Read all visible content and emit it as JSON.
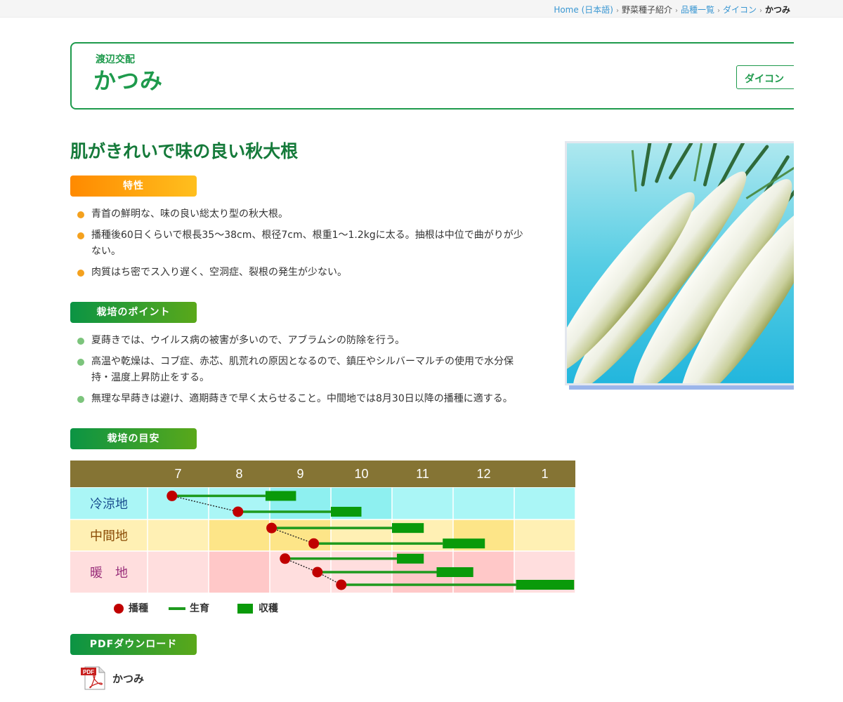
{
  "breadcrumb": {
    "home": "Home (日本語)",
    "items": [
      "野菜種子紹介",
      "品種一覧",
      "ダイコン"
    ],
    "current": "かつみ",
    "separator": "›"
  },
  "header": {
    "subtitle": "渡辺交配",
    "title": "かつみ",
    "category_button": "ダイコン"
  },
  "headline": "肌がきれいで味の良い秋大根",
  "features": {
    "label": "特性",
    "items": [
      "青首の鮮明な、味の良い総太り型の秋大根。",
      "播種後60日くらいで根長35〜38cm、根径7cm、根重1〜1.2kgに太る。抽根は中位で曲がりが少",
      "ない。",
      "肉質はち密でス入り遅く、空洞症、裂根の発生が少ない。"
    ]
  },
  "points": {
    "label": "栽培のポイント",
    "items": [
      "夏蒔きでは、ウイルス病の被害が多いので、アブラムシの防除を行う。",
      "高温や乾燥は、コブ症、赤芯、肌荒れの原因となるので、鎮圧やシルバーマルチの使用で水分保",
      "持・温度上昇防止をする。",
      "無理な早蒔きは避け、適期蒔きで早く太らせること。中間地では8月30日以降の播種に適する。"
    ]
  },
  "schedule": {
    "label": "栽培の目安",
    "months": [
      "7",
      "8",
      "9",
      "10",
      "11",
      "12",
      "1"
    ],
    "regions": [
      {
        "name": "冷涼地",
        "band_color": "#aaf6f6",
        "shade_color": "#8ef0f0",
        "shaded_months": [
          2,
          3
        ],
        "plans": [
          {
            "sow": 7.4,
            "grow_to": 8.93,
            "harvest_to": 9.43
          },
          {
            "sow": 8.48,
            "grow_to": 10.0,
            "harvest_to": 10.5
          }
        ]
      },
      {
        "name": "中間地",
        "band_color": "#fff0b4",
        "shade_color": "#fde588",
        "shaded_months": [
          1,
          2,
          5
        ],
        "plans": [
          {
            "sow": 9.03,
            "grow_to": 11.0,
            "harvest_to": 11.52
          },
          {
            "sow": 9.72,
            "grow_to": 11.83,
            "harvest_to": 12.52
          }
        ]
      },
      {
        "name": "暖　地",
        "band_color": "#ffdede",
        "shade_color": "#ffc8c8",
        "shaded_months": [
          1,
          4,
          5
        ],
        "plans": [
          {
            "sow": 9.25,
            "grow_to": 11.08,
            "harvest_to": 11.52
          },
          {
            "sow": 9.78,
            "grow_to": 11.73,
            "harvest_to": 12.33
          },
          {
            "sow": 10.17,
            "grow_to": 13.03,
            "harvest_to": 13.98
          }
        ]
      }
    ],
    "legend": {
      "sow": "播種",
      "grow": "生育",
      "harvest": "収穫"
    },
    "colors": {
      "header": "#857434",
      "sow": "#c00000",
      "line": "#1e9a1e"
    }
  },
  "pdf": {
    "label": "PDFダウンロード",
    "icon_text": "PDF",
    "file_name": "かつみ"
  }
}
